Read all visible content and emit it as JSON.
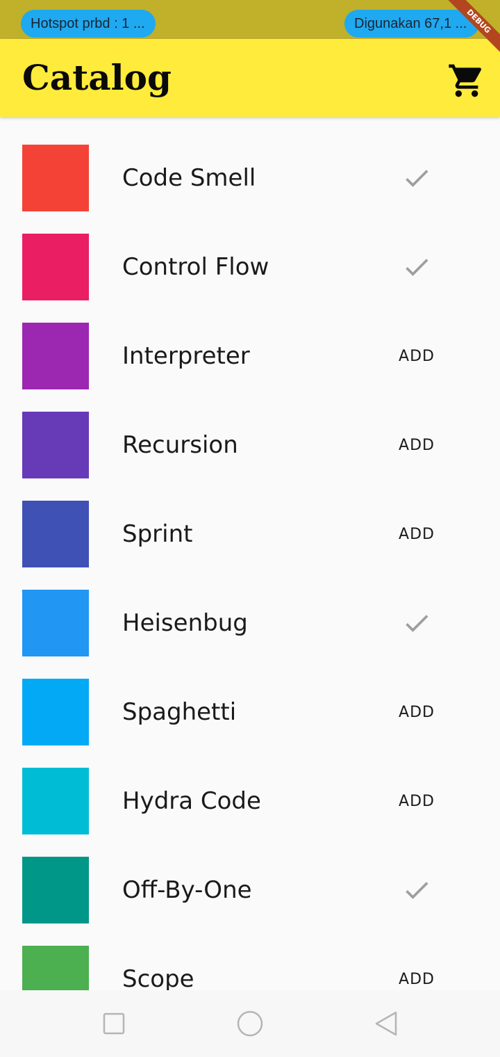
{
  "status_bar": {
    "hotspot_text": "Hotspot prbd : 1 ...",
    "usage_text": "Digunakan 67,1 ..."
  },
  "debug_banner": "DEBUG",
  "app_bar": {
    "title": "Catalog",
    "cart_icon": "shopping-cart-icon",
    "background": "#ffeb3b"
  },
  "catalog": {
    "items": [
      {
        "name": "Code Smell",
        "color": "#f44336",
        "in_cart": true,
        "action": "check-icon"
      },
      {
        "name": "Control Flow",
        "color": "#e91e63",
        "in_cart": true,
        "action": "check-icon"
      },
      {
        "name": "Interpreter",
        "color": "#9c27b0",
        "in_cart": false,
        "action": "ADD"
      },
      {
        "name": "Recursion",
        "color": "#673ab7",
        "in_cart": false,
        "action": "ADD"
      },
      {
        "name": "Sprint",
        "color": "#3f51b5",
        "in_cart": false,
        "action": "ADD"
      },
      {
        "name": "Heisenbug",
        "color": "#2196f3",
        "in_cart": true,
        "action": "check-icon"
      },
      {
        "name": "Spaghetti",
        "color": "#03a9f4",
        "in_cart": false,
        "action": "ADD"
      },
      {
        "name": "Hydra Code",
        "color": "#00bcd4",
        "in_cart": false,
        "action": "ADD"
      },
      {
        "name": "Off-By-One",
        "color": "#009688",
        "in_cart": true,
        "action": "check-icon"
      },
      {
        "name": "Scope",
        "color": "#4caf50",
        "in_cart": false,
        "action": "ADD"
      }
    ]
  },
  "nav_bar": {
    "recents_icon": "square-recents-icon",
    "home_icon": "circle-home-icon",
    "back_icon": "triangle-back-icon"
  }
}
